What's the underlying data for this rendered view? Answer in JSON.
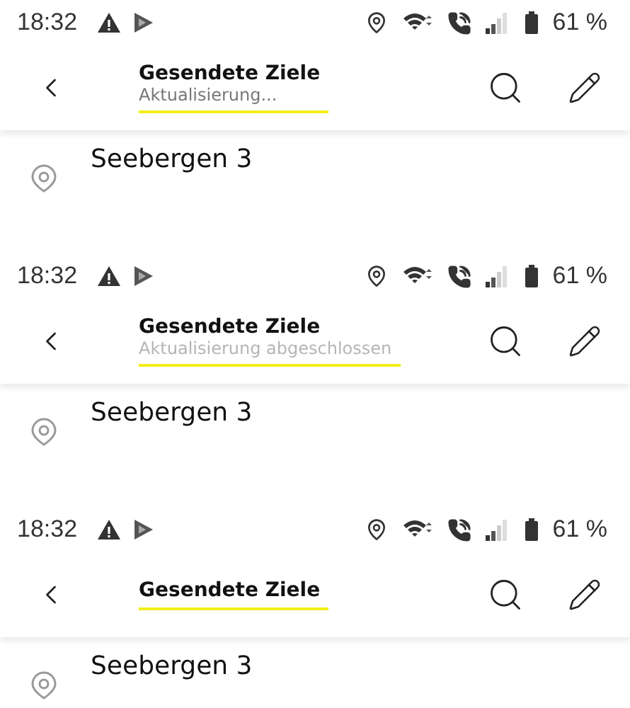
{
  "panels": [
    {
      "status_bar": {
        "time": "18:32",
        "battery": "61 %"
      },
      "app_bar": {
        "title": "Gesendete Ziele",
        "subtitle": "Aktualisierung...",
        "subtitle_dimmed": false,
        "highlighted": true
      },
      "list": [
        {
          "name": "Seebergen 3"
        }
      ]
    },
    {
      "status_bar": {
        "time": "18:32",
        "battery": "61 %"
      },
      "app_bar": {
        "title": "Gesendete Ziele",
        "subtitle": "Aktualisierung abgeschlossen",
        "subtitle_dimmed": true,
        "highlighted": true
      },
      "list": [
        {
          "name": "Seebergen 3"
        }
      ]
    },
    {
      "status_bar": {
        "time": "18:32",
        "battery": "61 %"
      },
      "app_bar": {
        "title": "Gesendete Ziele",
        "highlighted": true
      },
      "list": [
        {
          "name": "Seebergen 3"
        }
      ]
    }
  ]
}
